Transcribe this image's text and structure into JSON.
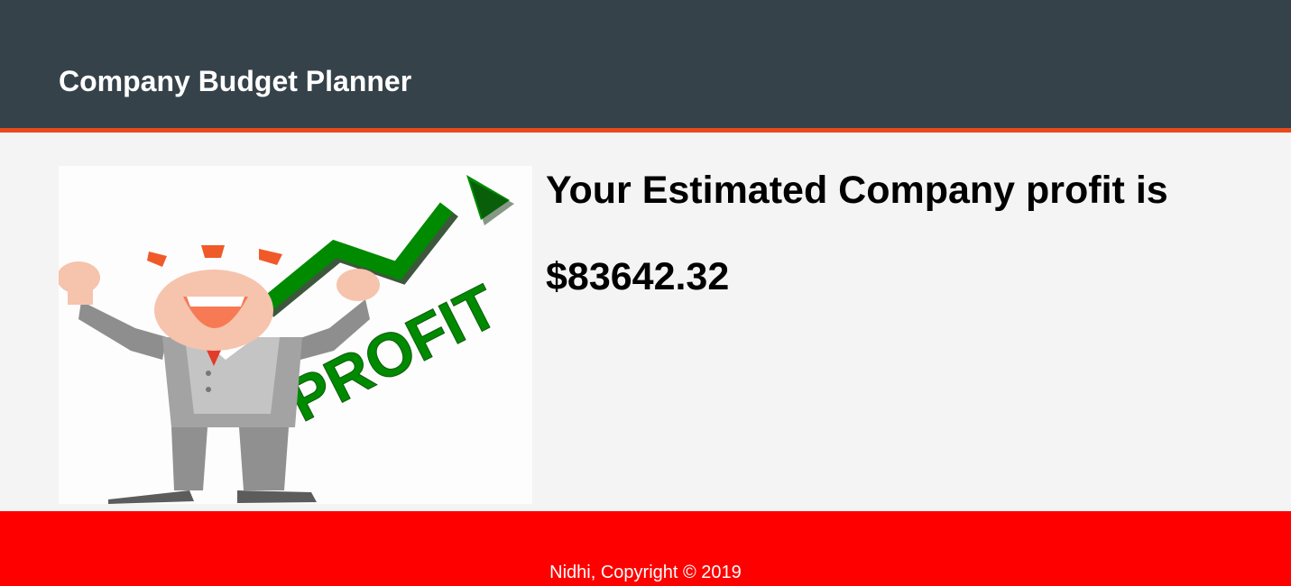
{
  "header": {
    "title": "Company Budget Planner",
    "background": "#35424a",
    "accent": "#e8491d"
  },
  "main": {
    "image": {
      "icon": "profit-businessman-illustration",
      "text": "PROFIT",
      "arrow_color": "#008000"
    },
    "heading": "Your Estimated Company profit is",
    "amount": "$83642.32"
  },
  "footer": {
    "text": "Nidhi, Copyright © 2019",
    "background": "#ff0000"
  }
}
